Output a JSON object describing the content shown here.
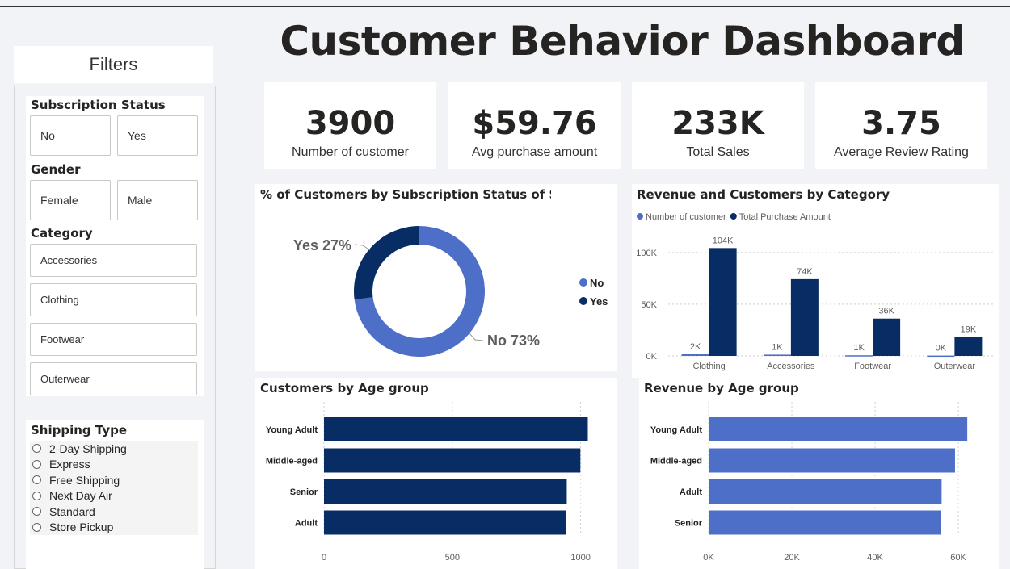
{
  "title": "Customer Behavior Dashboard",
  "filters": {
    "header": "Filters",
    "subscription": {
      "title": "Subscription Status",
      "options": [
        "No",
        "Yes"
      ]
    },
    "gender": {
      "title": "Gender",
      "options": [
        "Female",
        "Male"
      ]
    },
    "category": {
      "title": "Category",
      "options": [
        "Accessories",
        "Clothing",
        "Footwear",
        "Outerwear"
      ]
    },
    "shipping": {
      "title": "Shipping Type",
      "options": [
        "2-Day Shipping",
        "Express",
        "Free Shipping",
        "Next Day Air",
        "Standard",
        "Store Pickup"
      ]
    }
  },
  "kpis": [
    {
      "value": "3900",
      "label": "Number of customer"
    },
    {
      "value": "$59.76",
      "label": "Avg purchase amount"
    },
    {
      "value": "233K",
      "label": "Total Sales"
    },
    {
      "value": "3.75",
      "label": "Average Review Rating"
    }
  ],
  "colors": {
    "light": "#4d6fc8",
    "dark": "#082c64",
    "axis": "#605e5c",
    "grid": "#d0d0d0"
  },
  "chart_data": [
    {
      "type": "pie",
      "title": "% of Customers by Subscription Status of S",
      "categories": [
        "No",
        "Yes"
      ],
      "values": [
        73,
        27
      ],
      "slice_labels": [
        "No 73%",
        "Yes 27%"
      ],
      "donut": true,
      "legend": "right"
    },
    {
      "type": "bar",
      "title": "Revenue and Customers by Category",
      "categories": [
        "Clothing",
        "Accessories",
        "Footwear",
        "Outerwear"
      ],
      "series": [
        {
          "name": "Number of customer",
          "values": [
            1737,
            1240,
            599,
            324
          ],
          "labels": [
            "2K",
            "1K",
            "1K",
            "0K"
          ]
        },
        {
          "name": "Total Purchase Amount",
          "values": [
            104264,
            74200,
            36093,
            18524
          ],
          "labels": [
            "104K",
            "74K",
            "36K",
            "19K"
          ]
        }
      ],
      "yticks": [
        "0K",
        "50K",
        "100K"
      ],
      "ylim": [
        0,
        110000
      ],
      "legend": "top-left",
      "grid": true
    },
    {
      "type": "bar",
      "orientation": "horizontal",
      "title": "Customers by Age group",
      "categories": [
        "Young Adult",
        "Middle-aged",
        "Senior",
        "Adult"
      ],
      "values": [
        1028,
        999,
        946,
        944
      ],
      "xticks": [
        0,
        500,
        1000
      ],
      "xlim": [
        0,
        1080
      ],
      "grid": true
    },
    {
      "type": "bar",
      "orientation": "horizontal",
      "title": "Revenue by Age group",
      "categories": [
        "Young Adult",
        "Middle-aged",
        "Adult",
        "Senior"
      ],
      "values": [
        62143,
        59197,
        55978,
        55763
      ],
      "xticks": [
        "0K",
        "20K",
        "40K",
        "60K"
      ],
      "xlim": [
        0,
        66000
      ],
      "grid": true
    }
  ]
}
